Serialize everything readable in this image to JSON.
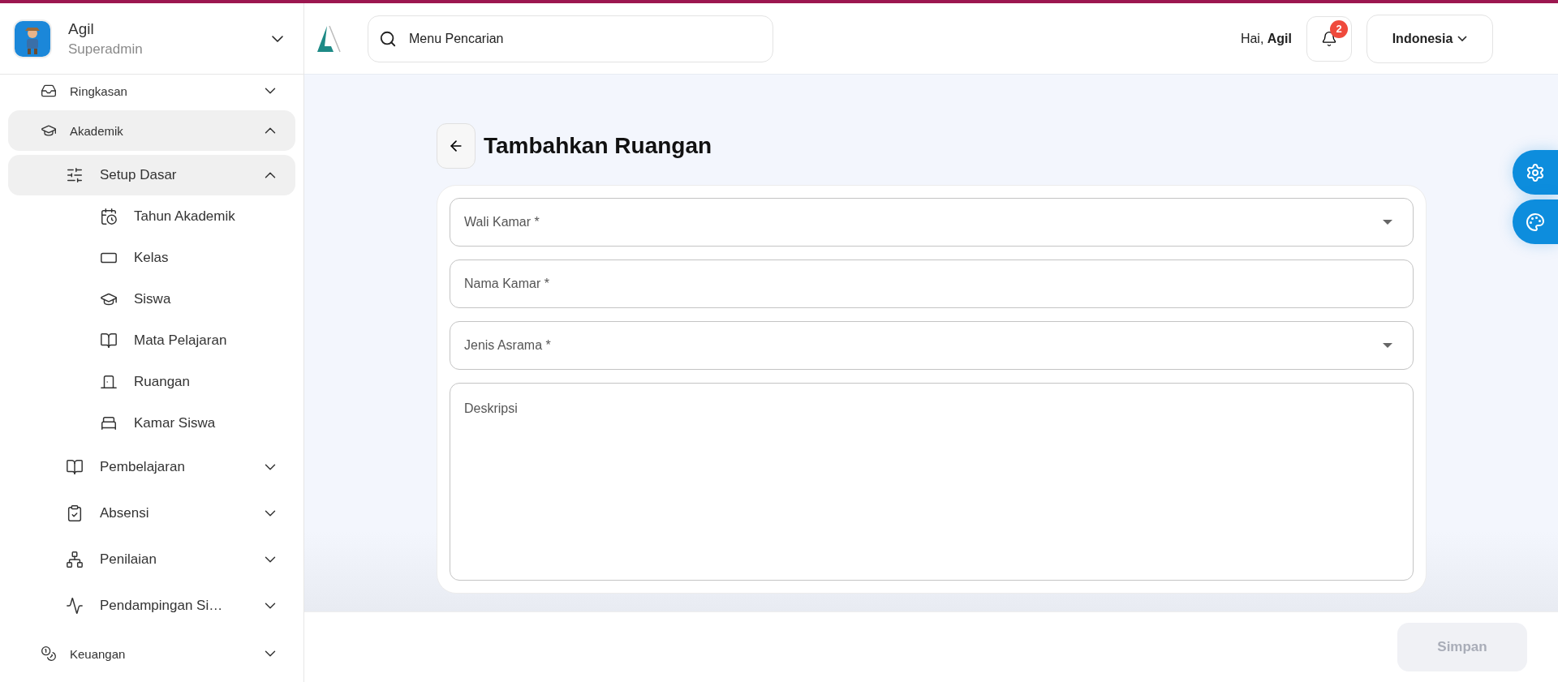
{
  "user": {
    "name": "Agil",
    "role": "Superadmin"
  },
  "sidebar": {
    "items": [
      {
        "label": "Ringkasan",
        "expanded": false
      },
      {
        "label": "Akademik",
        "expanded": true,
        "children": [
          {
            "label": "Setup Dasar",
            "expanded": true,
            "children": [
              {
                "label": "Tahun Akademik"
              },
              {
                "label": "Kelas"
              },
              {
                "label": "Siswa"
              },
              {
                "label": "Mata Pelajaran"
              },
              {
                "label": "Ruangan"
              },
              {
                "label": "Kamar Siswa"
              }
            ]
          },
          {
            "label": "Pembelajaran",
            "expanded": false
          },
          {
            "label": "Absensi",
            "expanded": false
          },
          {
            "label": "Penilaian",
            "expanded": false
          },
          {
            "label": "Pendampingan Si…",
            "expanded": false
          }
        ]
      },
      {
        "label": "Keuangan",
        "expanded": false
      }
    ]
  },
  "header": {
    "search": {
      "placeholder": "Menu Pencarian"
    },
    "greeting": "Hai,",
    "greeting_name": "Agil",
    "notification_count": "2",
    "language": "Indonesia"
  },
  "page": {
    "title": "Tambahkan Ruangan",
    "fields": [
      {
        "kind": "select",
        "label": "Wali Kamar *"
      },
      {
        "kind": "text",
        "label": "Nama Kamar *"
      },
      {
        "kind": "select",
        "label": "Jenis Asrama *"
      },
      {
        "kind": "textarea",
        "label": "Deskripsi"
      }
    ]
  },
  "footer": {
    "save": {
      "label": "Simpan",
      "disabled": true
    }
  }
}
